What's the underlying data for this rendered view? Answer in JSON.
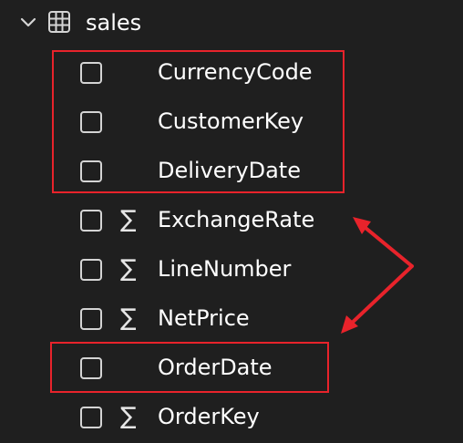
{
  "table": {
    "name": "sales",
    "expanded": true
  },
  "fields": [
    {
      "label": "CurrencyCode",
      "sigma": false,
      "checked": false
    },
    {
      "label": "CustomerKey",
      "sigma": false,
      "checked": false
    },
    {
      "label": "DeliveryDate",
      "sigma": false,
      "checked": false
    },
    {
      "label": "ExchangeRate",
      "sigma": true,
      "checked": false
    },
    {
      "label": "LineNumber",
      "sigma": true,
      "checked": false
    },
    {
      "label": "NetPrice",
      "sigma": true,
      "checked": false
    },
    {
      "label": "OrderDate",
      "sigma": false,
      "checked": false
    },
    {
      "label": "OrderKey",
      "sigma": true,
      "checked": false
    }
  ],
  "sigma_symbol": "∑",
  "colors": {
    "background": "#1f1f1f",
    "text": "#ffffff",
    "annotation": "#e8232b"
  }
}
